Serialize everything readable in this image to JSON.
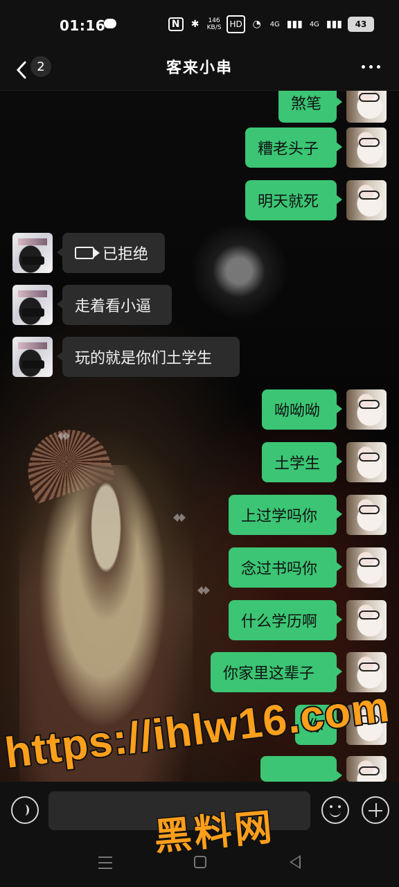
{
  "status": {
    "time": "01:16",
    "speed": "146\nKB/S",
    "hd": "HD",
    "signal_labels": [
      "4G",
      "4G"
    ],
    "battery": "43"
  },
  "header": {
    "back_count": "2",
    "title": "客来小串"
  },
  "messages": [
    {
      "side": "out",
      "text": "煞笔"
    },
    {
      "side": "out",
      "text": "糟老头子"
    },
    {
      "side": "out",
      "text": "明天就死"
    },
    {
      "side": "in",
      "text": "已拒绝",
      "icon": "video-icon"
    },
    {
      "side": "in",
      "text": "走着看小逼"
    },
    {
      "side": "in",
      "text": "玩的就是你们土学生"
    },
    {
      "side": "out",
      "text": "呦呦呦"
    },
    {
      "side": "out",
      "text": "土学生"
    },
    {
      "side": "out",
      "text": "上过学吗你"
    },
    {
      "side": "out",
      "text": "念过书吗你"
    },
    {
      "side": "out",
      "text": "什么学历啊"
    },
    {
      "side": "out",
      "text": "你家里这辈子"
    },
    {
      "side": "out",
      "text": "你"
    }
  ],
  "watermark": {
    "url": "https://ihlw16.com",
    "text": "黑料网"
  },
  "colors": {
    "outgoing_bubble": "#3bc574",
    "incoming_bubble": "#2c2c2c",
    "watermark": "#ff9f1c"
  }
}
